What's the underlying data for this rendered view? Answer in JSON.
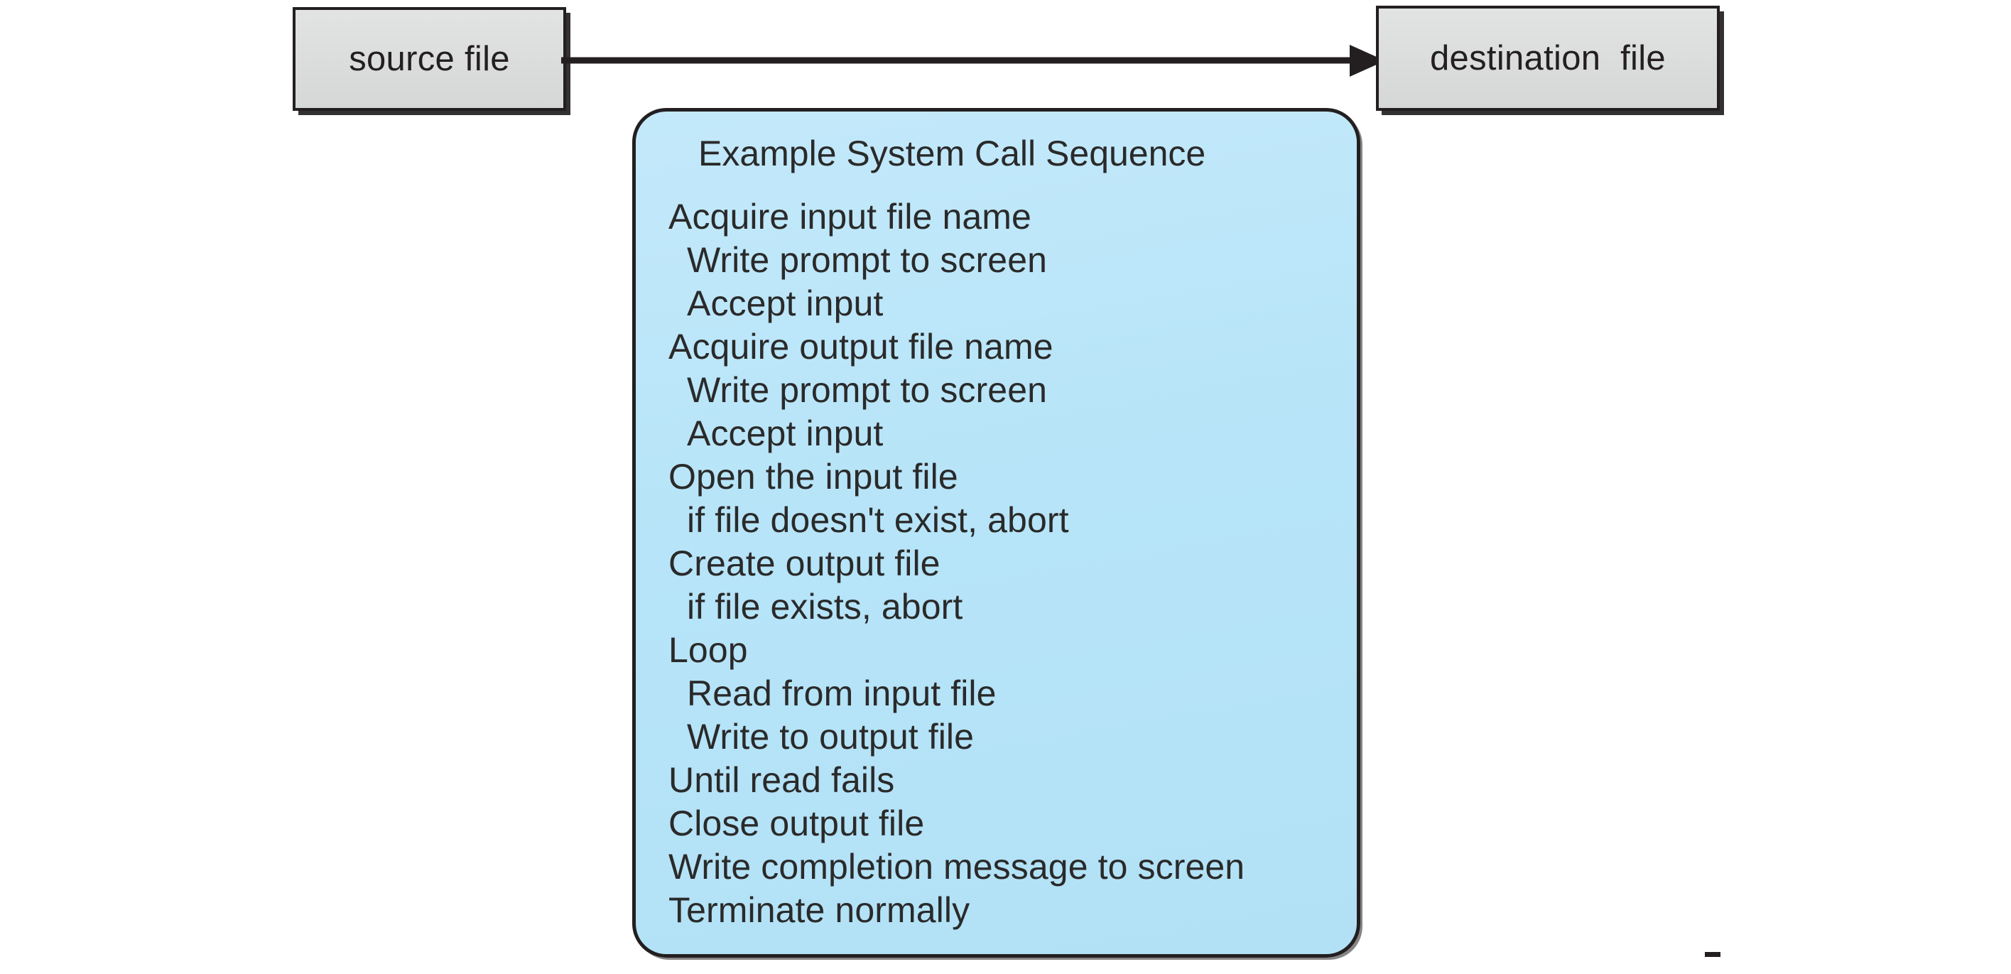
{
  "diagram": {
    "title": "Example System Call Sequence",
    "source_box": {
      "label": "source file",
      "fill_color": "#dcdddd",
      "border_color": "#231f20"
    },
    "destination_box": {
      "label": "destination  file",
      "fill_color": "#dcdddd",
      "border_color": "#231f20"
    },
    "arrow": {
      "direction": "left-to-right",
      "color": "#231f20",
      "from": "source file",
      "to": "destination  file"
    },
    "sequence_panel": {
      "fill_color": "#b9e5f8",
      "border_color": "#231f20",
      "title": "Example System Call Sequence",
      "steps": [
        {
          "text": "Acquire input file name",
          "indent": 0
        },
        {
          "text": "Write prompt to screen",
          "indent": 1
        },
        {
          "text": "Accept input",
          "indent": 1
        },
        {
          "text": "Acquire output file name",
          "indent": 0
        },
        {
          "text": "Write prompt to screen",
          "indent": 1
        },
        {
          "text": "Accept input",
          "indent": 1
        },
        {
          "text": "Open the input file",
          "indent": 0
        },
        {
          "text": "if file doesn't exist, abort",
          "indent": 1
        },
        {
          "text": "Create output file",
          "indent": 0
        },
        {
          "text": "if file exists, abort",
          "indent": 1
        },
        {
          "text": "Loop",
          "indent": 0
        },
        {
          "text": "Read from input file",
          "indent": 1
        },
        {
          "text": "Write to output file",
          "indent": 1
        },
        {
          "text": "Until read fails",
          "indent": 0
        },
        {
          "text": "Close output file",
          "indent": 0
        },
        {
          "text": "Write completion message to screen",
          "indent": 0
        },
        {
          "text": "Terminate normally",
          "indent": 0
        }
      ]
    }
  }
}
